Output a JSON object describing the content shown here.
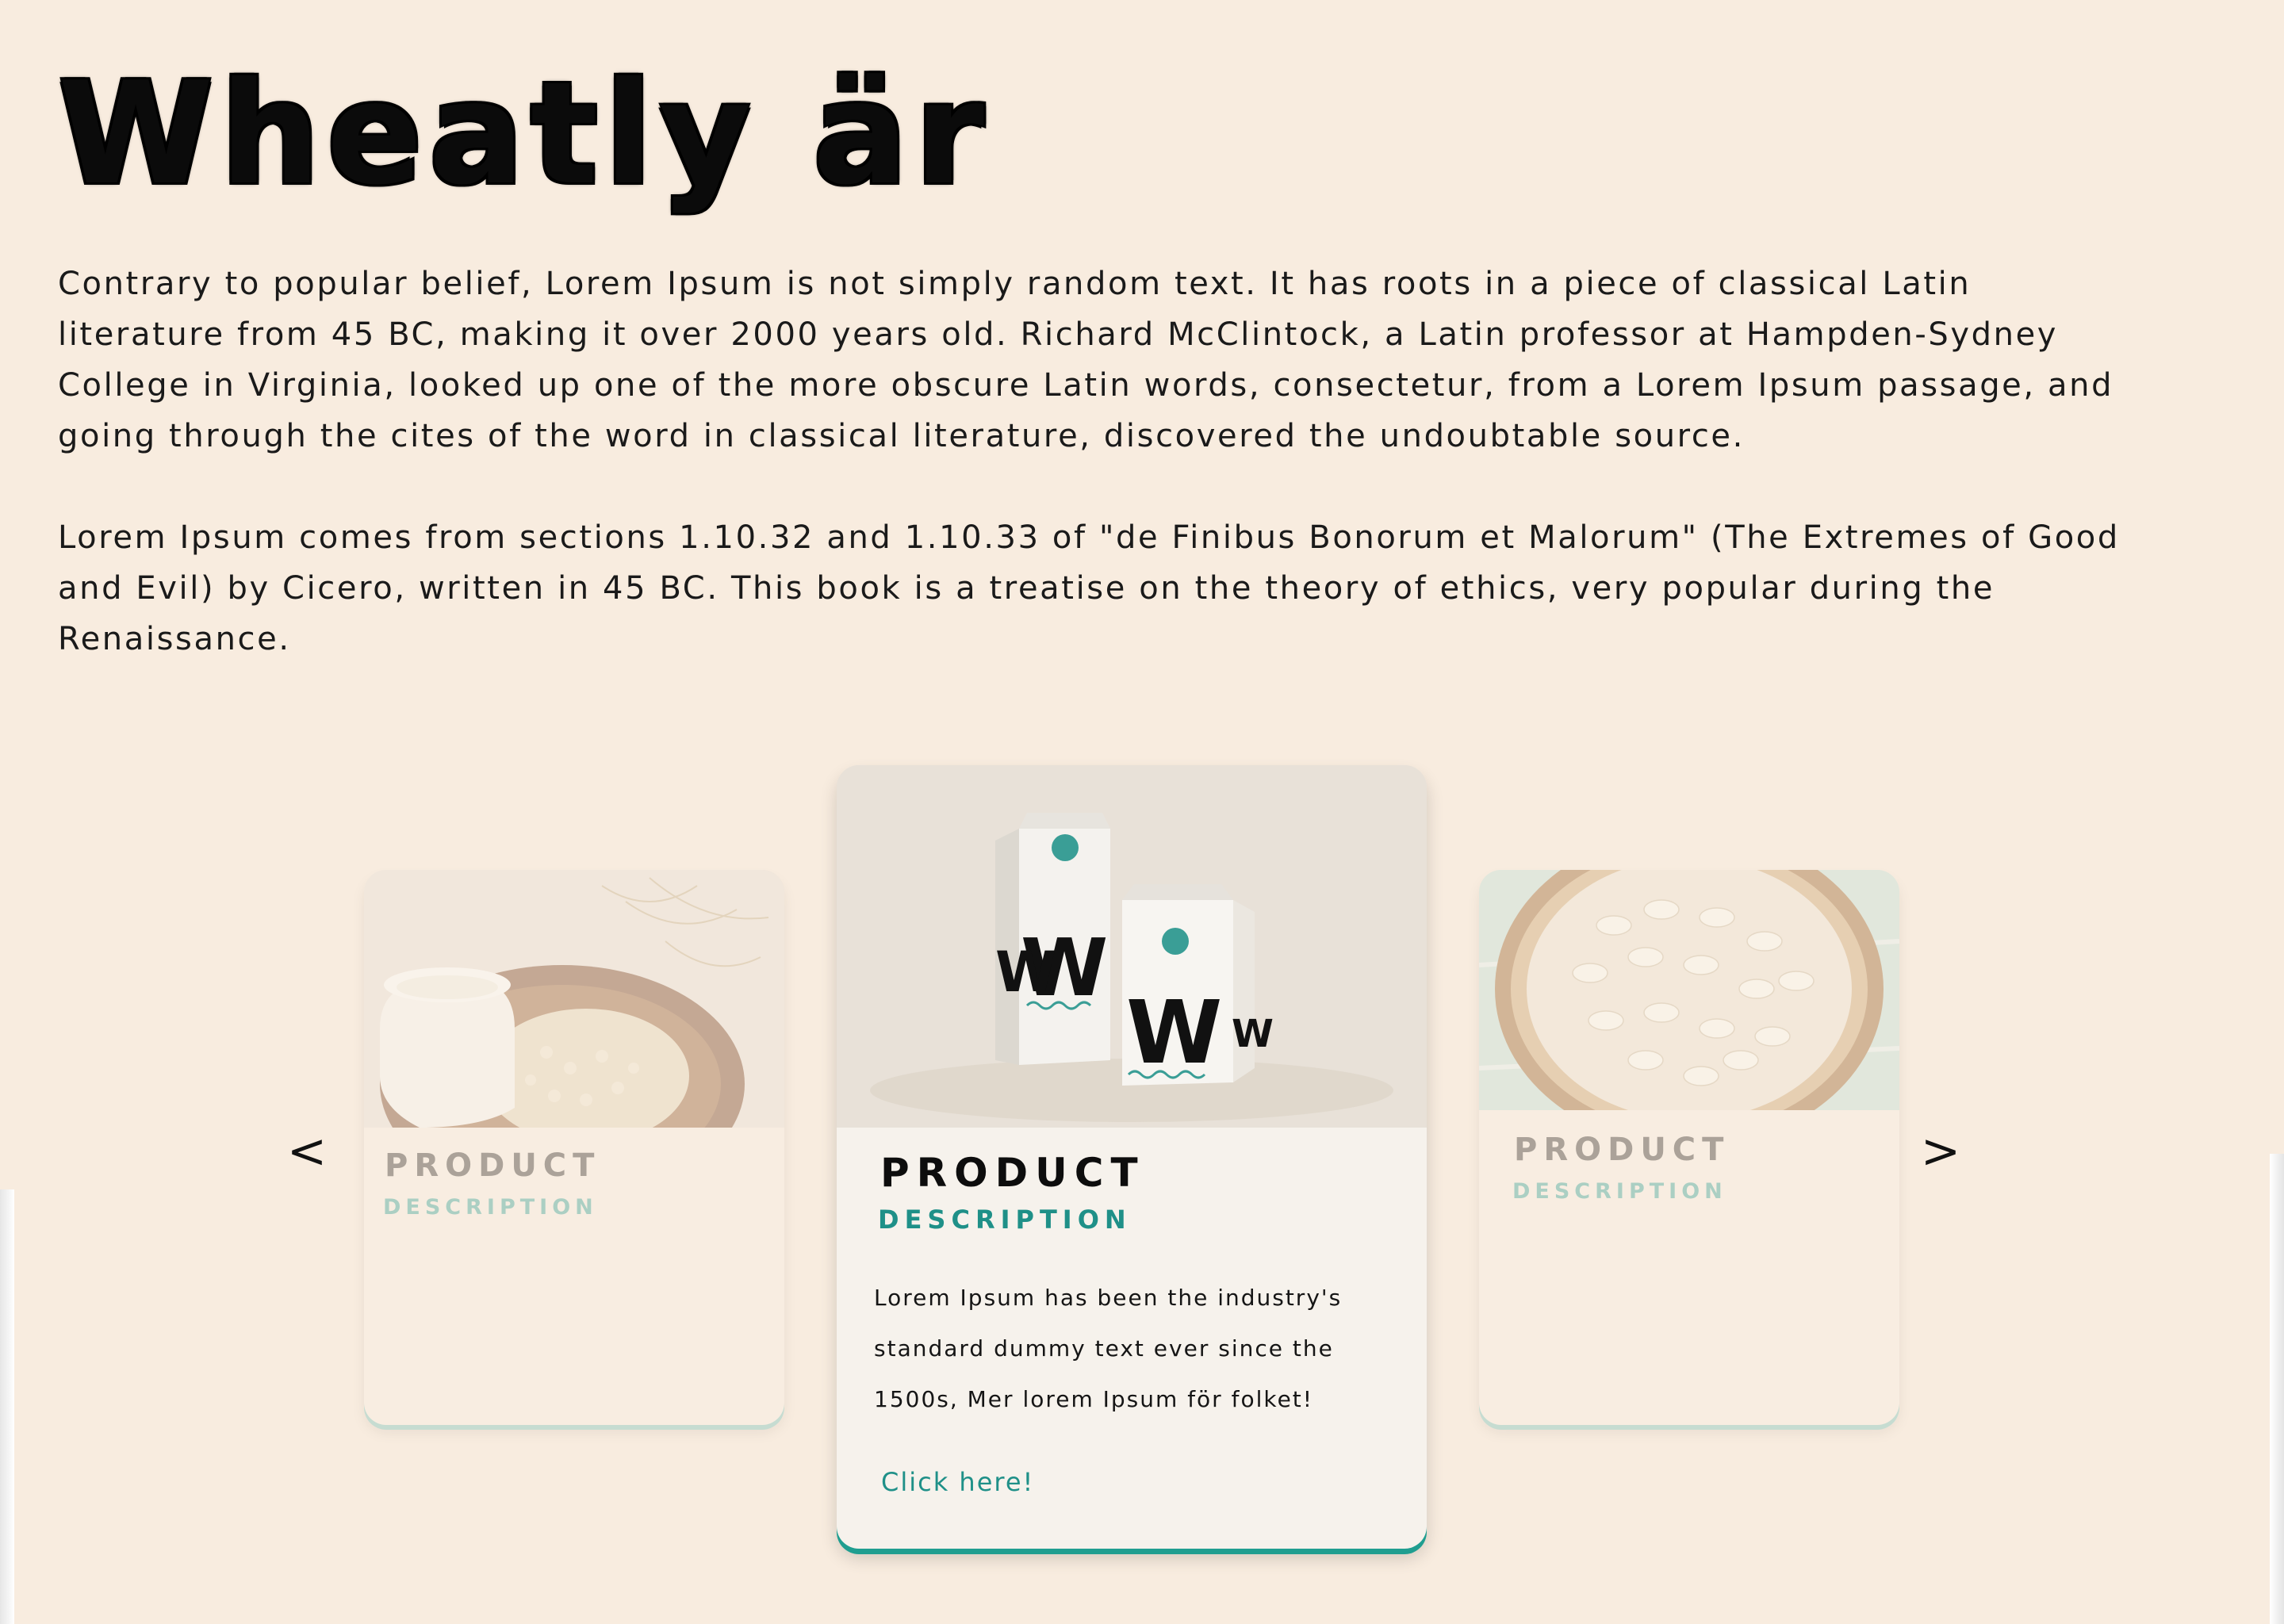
{
  "hero": {
    "title": "Wheatly är"
  },
  "intro": {
    "paragraph_1": "Contrary to popular belief, Lorem Ipsum is not simply random text. It has roots in a piece of classical Latin literature from 45 BC, making it over 2000 years old. Richard McClintock, a Latin professor at Hampden-Sydney College in Virginia, looked up one of the more obscure Latin words, consectetur, from a Lorem Ipsum passage, and going through the cites of the word in classical literature, discovered the undoubtable source.",
    "paragraph_2": "Lorem Ipsum comes from sections 1.10.32 and 1.10.33 of \"de Finibus Bonorum et Malorum\" (The Extremes of Good and Evil) by Cicero, written in 45 BC. This book is a treatise on the theory of ethics, very popular during the Renaissance."
  },
  "carousel": {
    "prev_icon": "<",
    "next_icon": ">",
    "cards": [
      {
        "title": "PRODUCT",
        "subtitle": "DESCRIPTION",
        "image": "milk-jug-and-oats-photo"
      },
      {
        "title": "PRODUCT",
        "subtitle": "DESCRIPTION",
        "image": "wheatly-milk-cartons-photo",
        "text": "Lorem Ipsum has been the industry's standard dummy text ever since the 1500s, Mer lorem Ipsum för folket!",
        "link": "Click here!"
      },
      {
        "title": "PRODUCT",
        "subtitle": "DESCRIPTION",
        "image": "oat-flakes-bowl-photo"
      }
    ]
  },
  "colors": {
    "background": "#f8ecdf",
    "accent": "#1f9088",
    "accent_light": "#6db8ad",
    "text": "#111111"
  }
}
